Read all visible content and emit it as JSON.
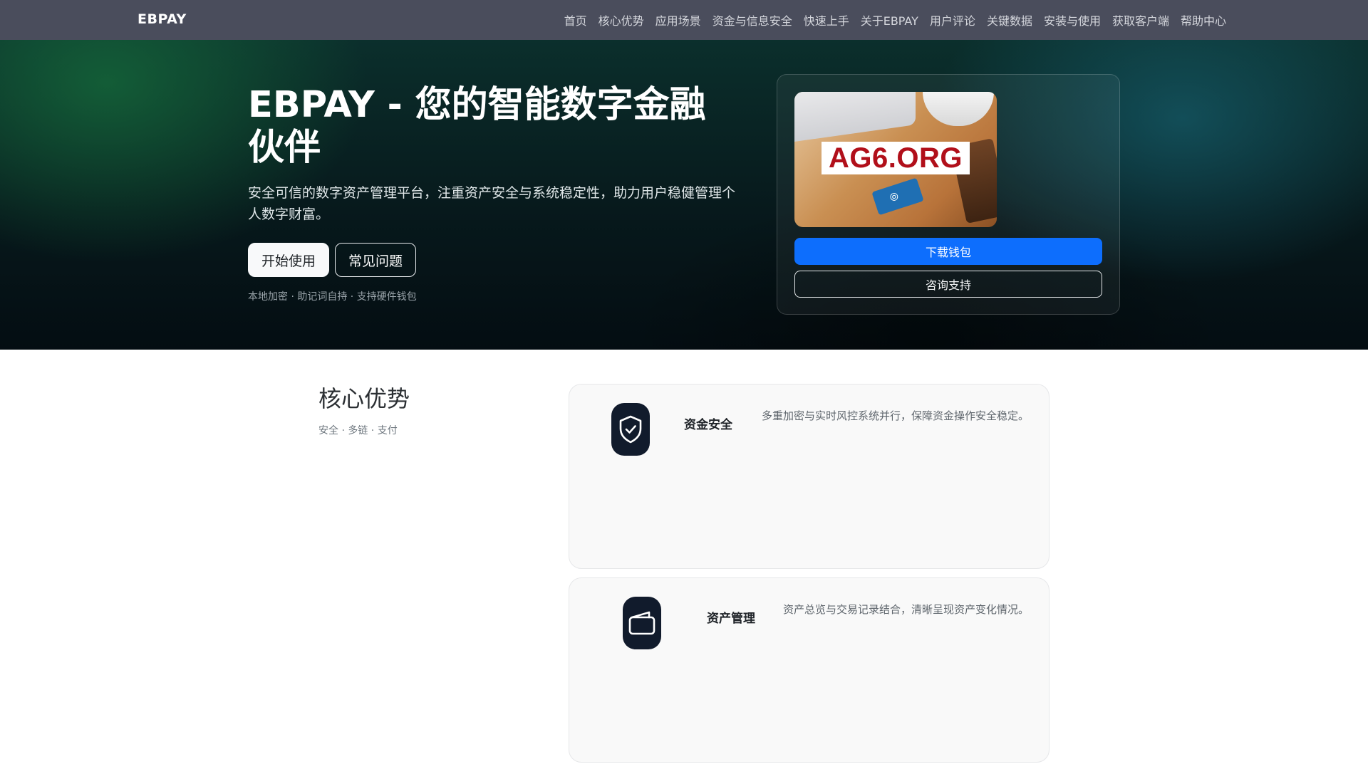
{
  "navbar": {
    "brand": "EBPAY",
    "links": [
      "首页",
      "核心优势",
      "应用场景",
      "资金与信息安全",
      "快速上手",
      "关于EBPAY",
      "用户评论",
      "关键数据",
      "安装与使用",
      "获取客户端",
      "帮助中心"
    ]
  },
  "hero": {
    "title": "EBPAY - 您的智能数字金融伙伴",
    "subtitle": "安全可信的数字资产管理平台，注重资产安全与系统稳定性，助力用户稳健管理个人数字财富。",
    "start_label": "开始使用",
    "faq_label": "常见问题",
    "tags": "本地加密 · 助记词自持 · 支持硬件钱包"
  },
  "hero_card": {
    "image_watermark": "AG6.ORG",
    "download_label": "下载钱包",
    "support_label": "咨询支持"
  },
  "features": {
    "title": "核心优势",
    "tags": "安全 · 多链 · 支付",
    "items": [
      {
        "icon": "shield-check-icon",
        "title": "资金安全",
        "desc": "多重加密与实时风控系统并行，保障资金操作安全稳定。"
      },
      {
        "icon": "wallet-icon",
        "title": "资产管理",
        "desc": "资产总览与交易记录结合，清晰呈现资产变化情况。"
      }
    ]
  },
  "colors": {
    "navbar_bg": "#4a4d5c",
    "primary": "#0d6efd",
    "icon_bg": "#111b2c",
    "watermark_red": "#b10f1a"
  }
}
